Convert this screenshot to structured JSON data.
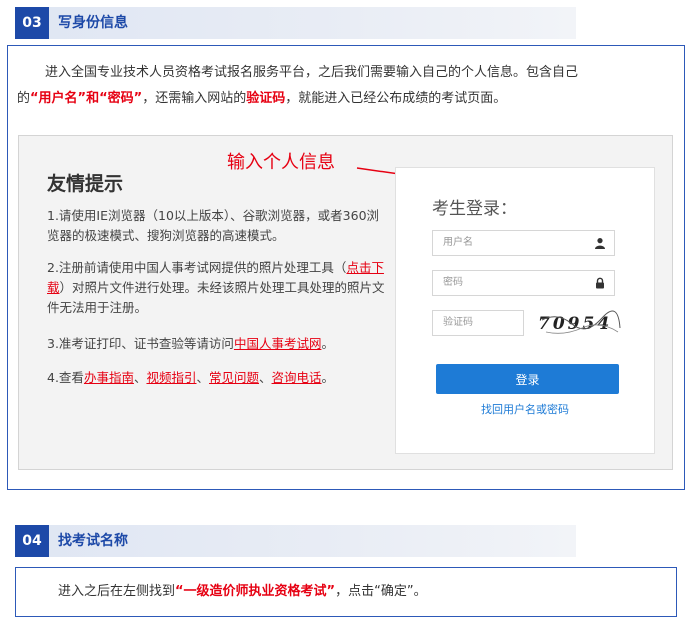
{
  "section3": {
    "number": "03",
    "title": "写身份信息",
    "para_line1": "进入全国专业技术人员资格考试报名服务平台，之后我们需要输入自己的个人信息。包含自己",
    "para_line2_a": "的",
    "para_line2_b": "“用户名”和“密码”",
    "para_line2_c": "，还需输入网站的",
    "para_line2_d": "验证码",
    "para_line2_e": "，就能进入已经公布成绩的考试页面。"
  },
  "screenshot": {
    "tips_title": "友情提示",
    "tip1": "1.请使用IE浏览器（10以上版本）、谷歌浏览器，或者360浏览器的极速模式、搜狗浏览器的高速模式。",
    "tip2_a": "2.注册前请使用中国人事考试网提供的照片处理工具（",
    "tip2_link": "点击下载",
    "tip2_b": "）对照片文件进行处理。未经该照片处理工具处理的照片文件无法用于注册。",
    "tip3_a": "3.准考证打印、证书查验等请访问",
    "tip3_link": "中国人事考试网",
    "tip3_b": "。",
    "tip4_a": "4.查看",
    "tip4_link1": "办事指南",
    "tip4_sep1": "、",
    "tip4_link2": "视频指引",
    "tip4_sep2": "、",
    "tip4_link3": "常见问题",
    "tip4_sep3": "、",
    "tip4_link4": "咨询电话",
    "tip4_end": "。",
    "annotation": "输入个人信息",
    "login_title": "考生登录：",
    "username_placeholder": "用户名",
    "password_placeholder": "密码",
    "captcha_placeholder": "验证码",
    "captcha_text": "70954",
    "login_button": "登录",
    "forgot_link": "找回用户名或密码"
  },
  "section4": {
    "number": "04",
    "title": "找考试名称",
    "para_a": "进入之后在左侧找到",
    "para_b": "“一级造价师执业资格考试”",
    "para_c": "，点击“确定”。"
  },
  "colors": {
    "accent": "#1d49a8",
    "highlight": "#e60012",
    "button": "#1e7bd6"
  }
}
